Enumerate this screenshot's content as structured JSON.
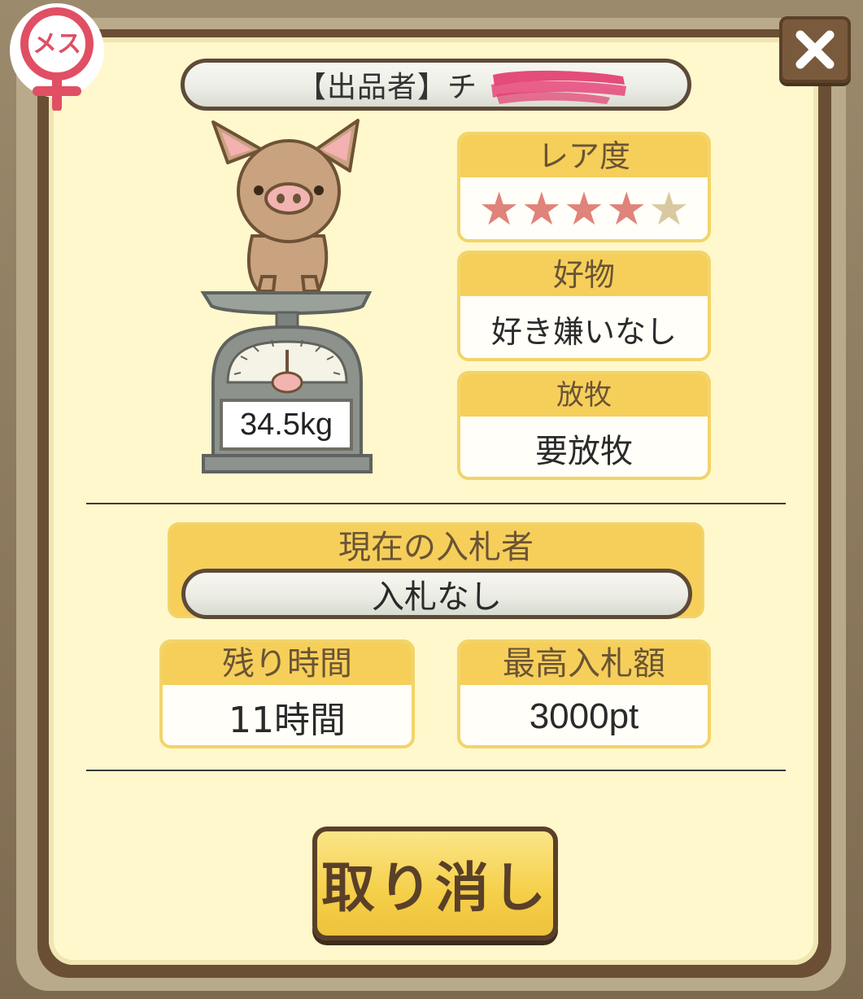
{
  "gender_badge": {
    "label": "メス",
    "color": "#e04f63"
  },
  "close_icon": "close-icon",
  "seller": {
    "label": "【出品者】チ"
  },
  "pig": {
    "weight": "34.5kg"
  },
  "rarity": {
    "title": "レア度",
    "rating": 4,
    "max": 5,
    "filled_color": "#e0837a",
    "empty_color": "#d8c9a0"
  },
  "favorite": {
    "title": "好物",
    "value": "好き嫌いなし"
  },
  "grazing": {
    "title": "放牧",
    "value": "要放牧"
  },
  "bidder": {
    "title": "現在の入札者",
    "value": "入札なし"
  },
  "time_left": {
    "title": "残り時間",
    "value": "11時間"
  },
  "top_bid": {
    "title": "最高入札額",
    "value": "3000pt"
  },
  "cancel_button": {
    "label": "取り消し"
  }
}
